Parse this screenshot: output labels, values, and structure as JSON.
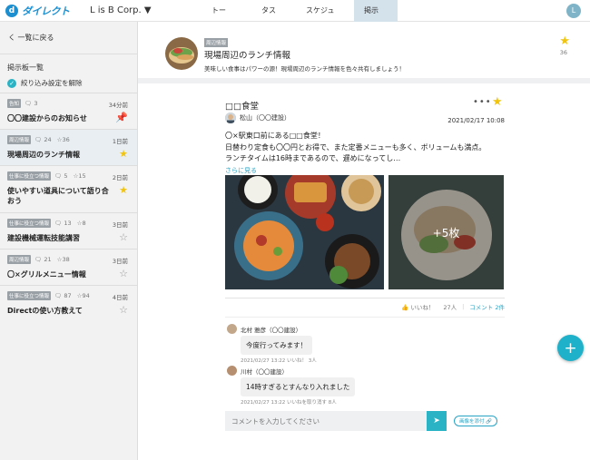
{
  "header": {
    "logo_letter": "d",
    "logo_text": "ダイレクト",
    "org": "L is B Corp. ▼",
    "tabs": [
      {
        "label": "トーク"
      },
      {
        "label": "タスク"
      },
      {
        "label": "スケジュール"
      },
      {
        "label": "掲示板",
        "active": true
      }
    ],
    "user_initial": "L"
  },
  "sidebar": {
    "back_label": "く 一覧に戻る",
    "section_title": "掲示板一覧",
    "filter_label": "絞り込み設定を解除",
    "items": [
      {
        "category": "告知",
        "comments": "3",
        "stars": "",
        "time": "34分前",
        "title": "〇〇建設からのお知らせ",
        "icon": "pin-icon",
        "icon_glyph": "📌"
      },
      {
        "category": "周辺情報",
        "comments": "24",
        "stars": "36",
        "time": "1日前",
        "title": "現場周辺のランチ情報",
        "icon": "star-filled-icon",
        "icon_glyph": "★"
      },
      {
        "category": "仕事に役立つ情報",
        "comments": "5",
        "stars": "15",
        "time": "2日前",
        "title": "使いやすい道具について語り合おう",
        "icon": "star-filled-icon",
        "icon_glyph": "★"
      },
      {
        "category": "仕事に役立つ情報",
        "comments": "13",
        "stars": "8",
        "time": "3日前",
        "title": "建設機械運転技能講習",
        "icon": "star-empty-icon",
        "icon_glyph": "☆"
      },
      {
        "category": "周辺情報",
        "comments": "21",
        "stars": "38",
        "time": "3日前",
        "title": "〇×グリルメニュー情報",
        "icon": "star-empty-icon",
        "icon_glyph": "☆"
      },
      {
        "category": "仕事に役立つ情報",
        "comments": "87",
        "stars": "94",
        "time": "4日前",
        "title": "Directの使い方教えて",
        "icon": "star-empty-icon",
        "icon_glyph": "☆"
      }
    ]
  },
  "board": {
    "category": "周辺情報",
    "title": "現場周辺のランチ情報",
    "description": "美味しい食事はパワーの源！現場周辺のランチ情報を色々共有しましょう！",
    "star_count": "36"
  },
  "post": {
    "title": "□□食堂",
    "author": "松山（〇〇建設）",
    "date": "2021/02/17 10:08",
    "body_lines": [
      "〇×駅東口前にある□□食堂！",
      "日替わり定食も〇〇円とお得で、また定番メニューも多く、ボリュームも満点。",
      "ランチタイムは16時まであるので、遅めになってし…"
    ],
    "more_label": "さらに見る",
    "extra_photos": "+5枚",
    "likes_label": "いいね！",
    "likes_count": "27人",
    "comments_label": "コメント 2件"
  },
  "comments": [
    {
      "author": "北村 雅彦（〇〇建設）",
      "text": "今度行ってみます！",
      "footer": "2021/02/27 13:22 いいね！ 3人"
    },
    {
      "author": "川村（〇〇建設）",
      "text": "14時すぎるとすんなり入れました",
      "footer": "2021/02/27 13:22 いいねを取り消す 8人"
    }
  ],
  "composer": {
    "placeholder": "コメントを入力してください",
    "attach_label": "画像を添付 🔗"
  },
  "colors": {
    "accent": "#29b3c4",
    "brand": "#1b8fd0",
    "star": "#f1c40f"
  }
}
